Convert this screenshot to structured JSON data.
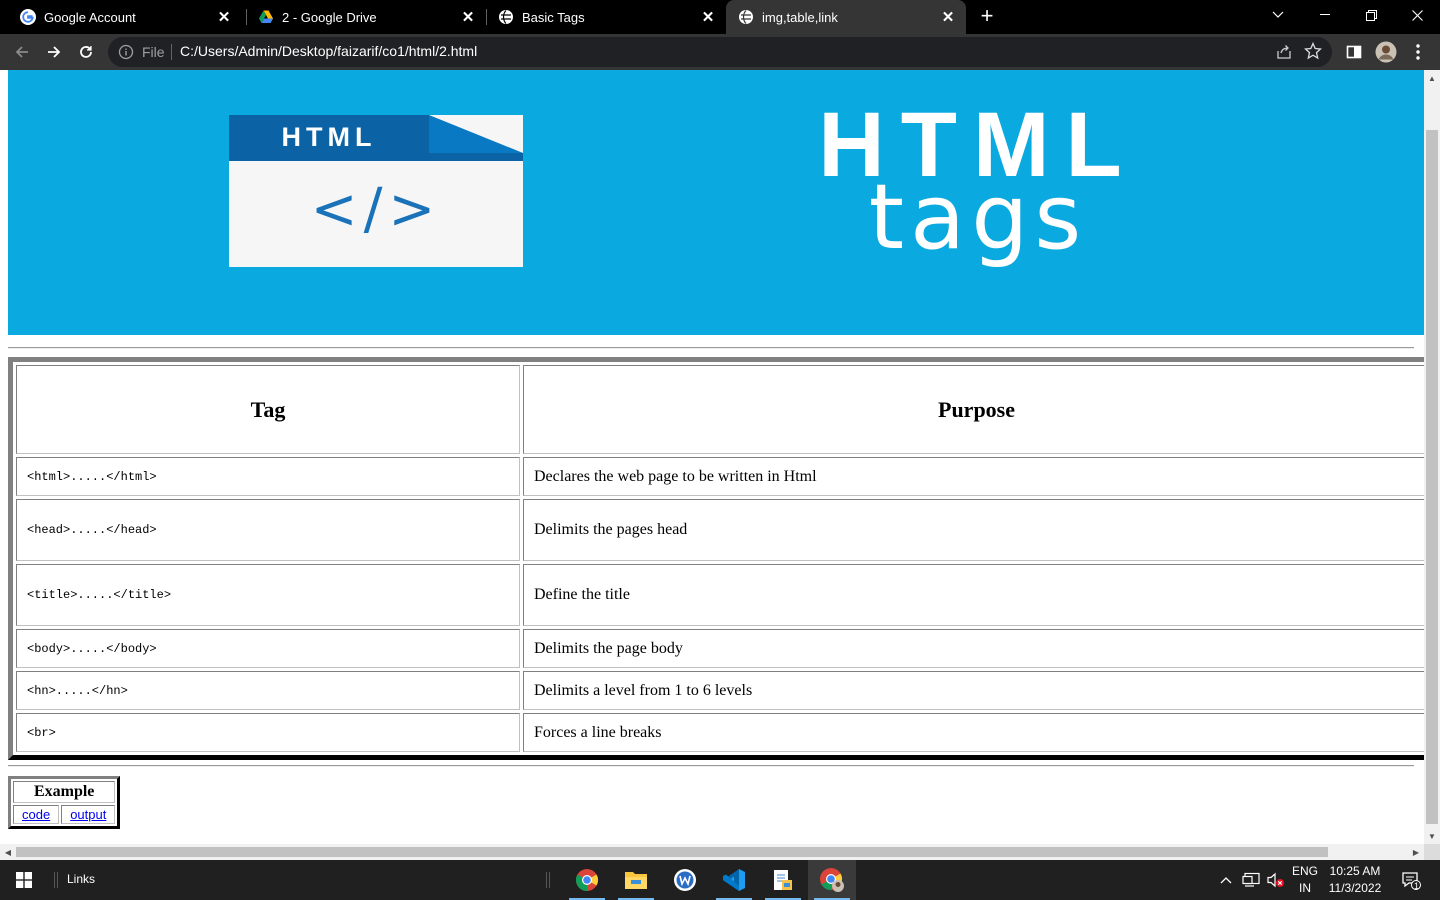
{
  "browser": {
    "tabs": [
      {
        "title": "Google Account",
        "icon": "google-g-icon",
        "active": false
      },
      {
        "title": "2 - Google Drive",
        "icon": "google-drive-icon",
        "active": false
      },
      {
        "title": "Basic Tags",
        "icon": "globe-icon",
        "active": false
      },
      {
        "title": "img,table,link",
        "icon": "globe-icon",
        "active": true
      }
    ],
    "omnibox": {
      "scheme_label": "File",
      "url": "C:/Users/Admin/Desktop/faizarif/co1/html/2.html"
    }
  },
  "page": {
    "banner": {
      "file_label": "HTML",
      "code_symbol": "</>",
      "title": "HTML",
      "subtitle": "tags",
      "background_color": "#0aa9e0",
      "file_header_color": "#0b63a6"
    },
    "table": {
      "headers": {
        "tag": "Tag",
        "purpose": "Purpose"
      },
      "rows": [
        {
          "tag": "<html>.....</html>",
          "purpose": "Declares the web page to be written in Html"
        },
        {
          "tag": "<head>.....</head>",
          "purpose": "Delimits the pages head"
        },
        {
          "tag": "<title>.....</title>",
          "purpose": "Define the title"
        },
        {
          "tag": "<body>.....</body>",
          "purpose": "Delimits the page body"
        },
        {
          "tag": "<hn>.....</hn>",
          "purpose": "Delimits a level from 1 to 6 levels"
        },
        {
          "tag": "<br>",
          "purpose": "Forces a line breaks"
        }
      ]
    },
    "example": {
      "heading": "Example",
      "links": [
        "code",
        "output"
      ]
    }
  },
  "taskbar": {
    "links_label": "Links",
    "apps": [
      "chrome-icon",
      "file-explorer-icon",
      "word-app-icon",
      "vscode-icon",
      "notepad-icon",
      "chrome-profile-icon"
    ],
    "language": {
      "line1": "ENG",
      "line2": "IN"
    },
    "clock": {
      "time": "10:25 AM",
      "date": "11/3/2022"
    },
    "notification_count": "1"
  }
}
